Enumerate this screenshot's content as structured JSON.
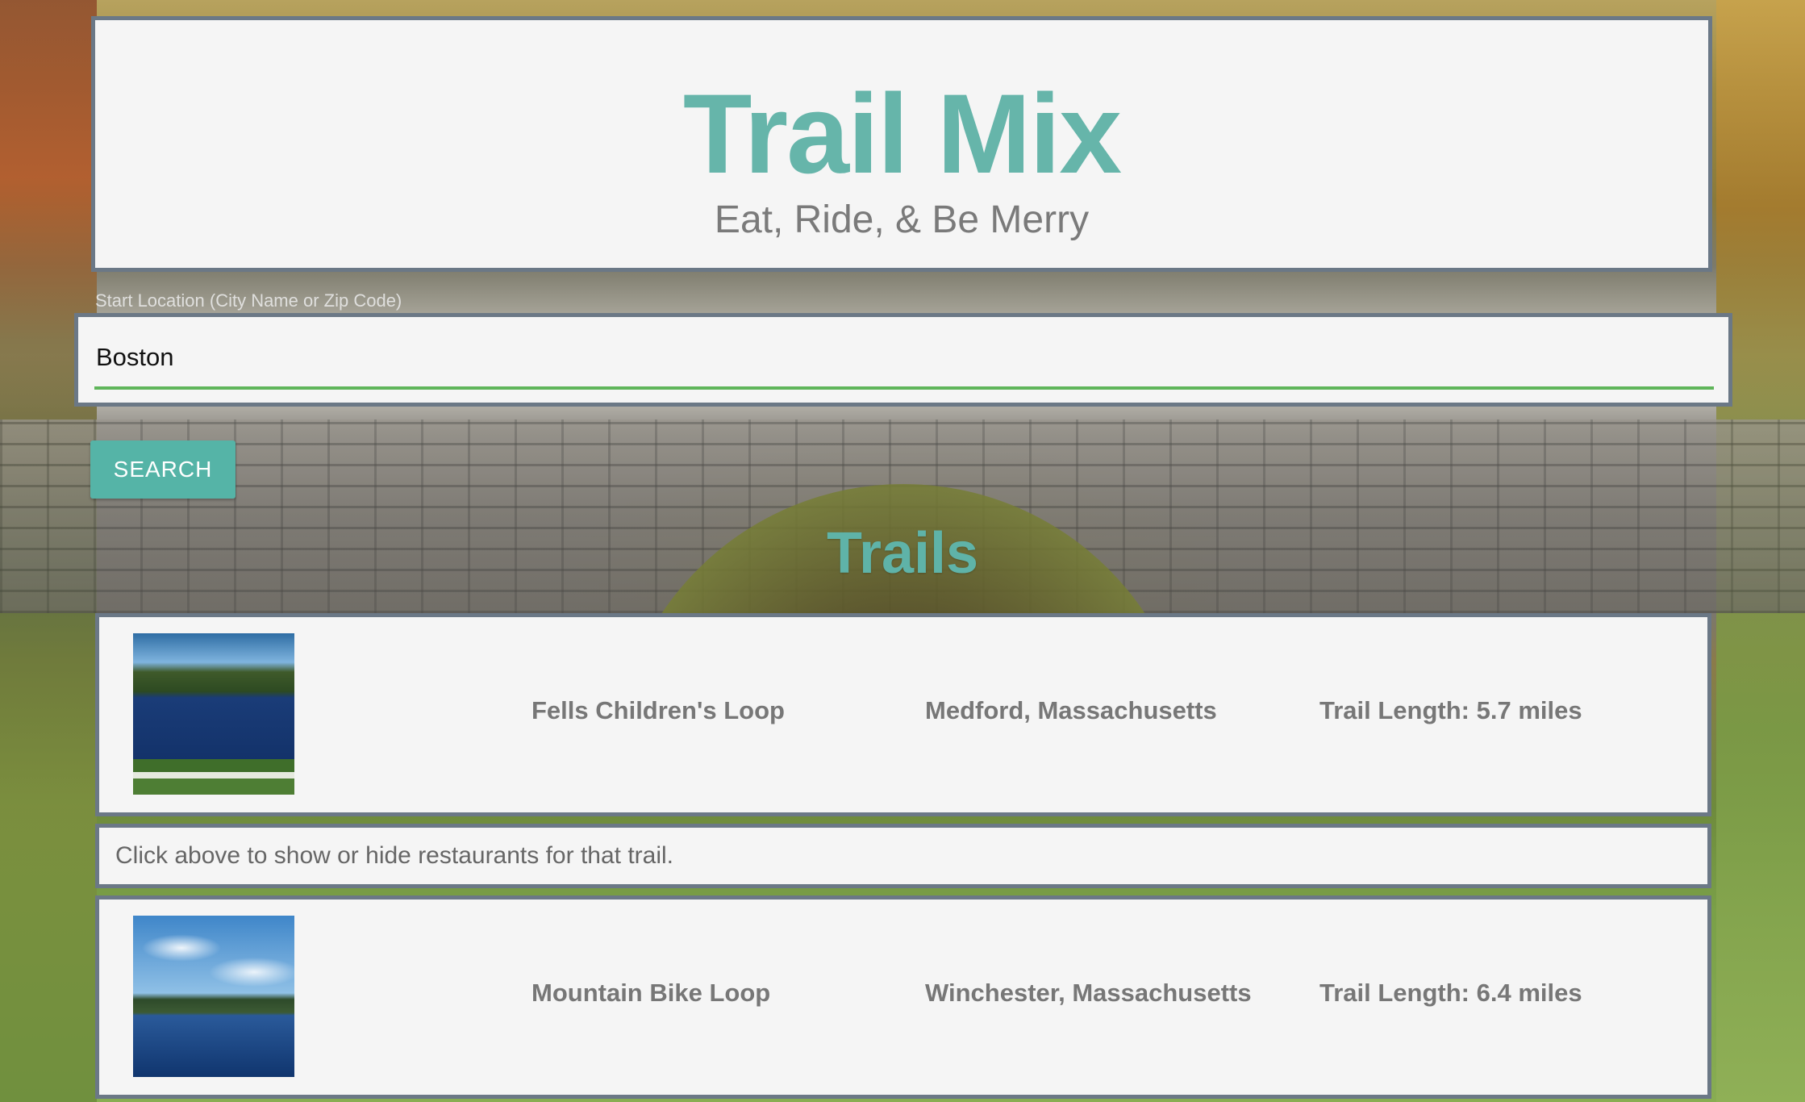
{
  "header": {
    "title": "Trail Mix",
    "tagline": "Eat, Ride, & Be Merry"
  },
  "search": {
    "label": "Start Location (City Name or Zip Code)",
    "value": "Boston",
    "button_label": "SEARCH"
  },
  "trails_section": {
    "heading": "Trails",
    "hint": "Click above to show or hide restaurants for that trail.",
    "items": [
      {
        "name": "Fells Children's Loop",
        "location": "Medford, Massachusetts",
        "length": "Trail Length: 5.7 miles"
      },
      {
        "name": "Mountain Bike Loop",
        "location": "Winchester, Massachusetts",
        "length": "Trail Length: 6.4 miles"
      }
    ]
  },
  "colors": {
    "accent_teal": "#66b5aa",
    "button": "#55b4a7",
    "input_underline": "#5fb55a",
    "card_border": "#6b7886",
    "card_background": "#f5f5f5"
  }
}
